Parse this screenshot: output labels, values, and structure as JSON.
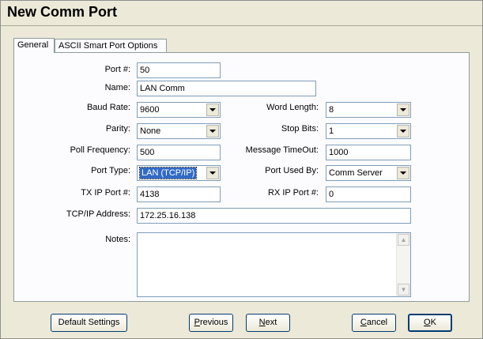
{
  "window": {
    "title": "New Comm Port"
  },
  "tabs": [
    {
      "label": "General",
      "active": true
    },
    {
      "label": "ASCII Smart Port Options",
      "active": false
    }
  ],
  "form": {
    "port_num": {
      "label": "Port #:",
      "value": "50"
    },
    "name": {
      "label": "Name:",
      "value": "LAN Comm"
    },
    "baud_rate": {
      "label": "Baud Rate:",
      "value": "9600"
    },
    "word_length": {
      "label": "Word Length:",
      "value": "8"
    },
    "parity": {
      "label": "Parity:",
      "value": "None"
    },
    "stop_bits": {
      "label": "Stop Bits:",
      "value": "1"
    },
    "poll_frequency": {
      "label": "Poll Frequency:",
      "value": "500"
    },
    "message_timeout": {
      "label": "Message TimeOut:",
      "value": "1000"
    },
    "port_type": {
      "label": "Port Type:",
      "value": "LAN (TCP/IP)"
    },
    "port_used_by": {
      "label": "Port Used By:",
      "value": "Comm Server"
    },
    "tx_ip_port": {
      "label": "TX  IP Port #:",
      "value": "4138"
    },
    "rx_ip_port": {
      "label": "RX  IP Port #:",
      "value": "0"
    },
    "tcpip_address": {
      "label": "TCP/IP Address:",
      "value": "172.25.16.138"
    },
    "notes": {
      "label": "Notes:",
      "value": ""
    }
  },
  "buttons": {
    "default_settings": "Default Settings",
    "previous": {
      "underlined": "P",
      "rest": "revious"
    },
    "next": {
      "underlined": "N",
      "rest": "ext"
    },
    "cancel": {
      "underlined": "C",
      "rest": "ancel"
    },
    "ok": {
      "underlined": "O",
      "rest": "K"
    }
  },
  "icons": {
    "dropdown_arrow": "chevron-down-icon",
    "scroll_up": "scroll-up-icon",
    "scroll_down": "scroll-down-icon"
  },
  "colors": {
    "dialog_bg": "#ece9d8",
    "panel_bg": "#fcfcfe",
    "field_border": "#7f9db9",
    "selection": "#316ac5"
  }
}
